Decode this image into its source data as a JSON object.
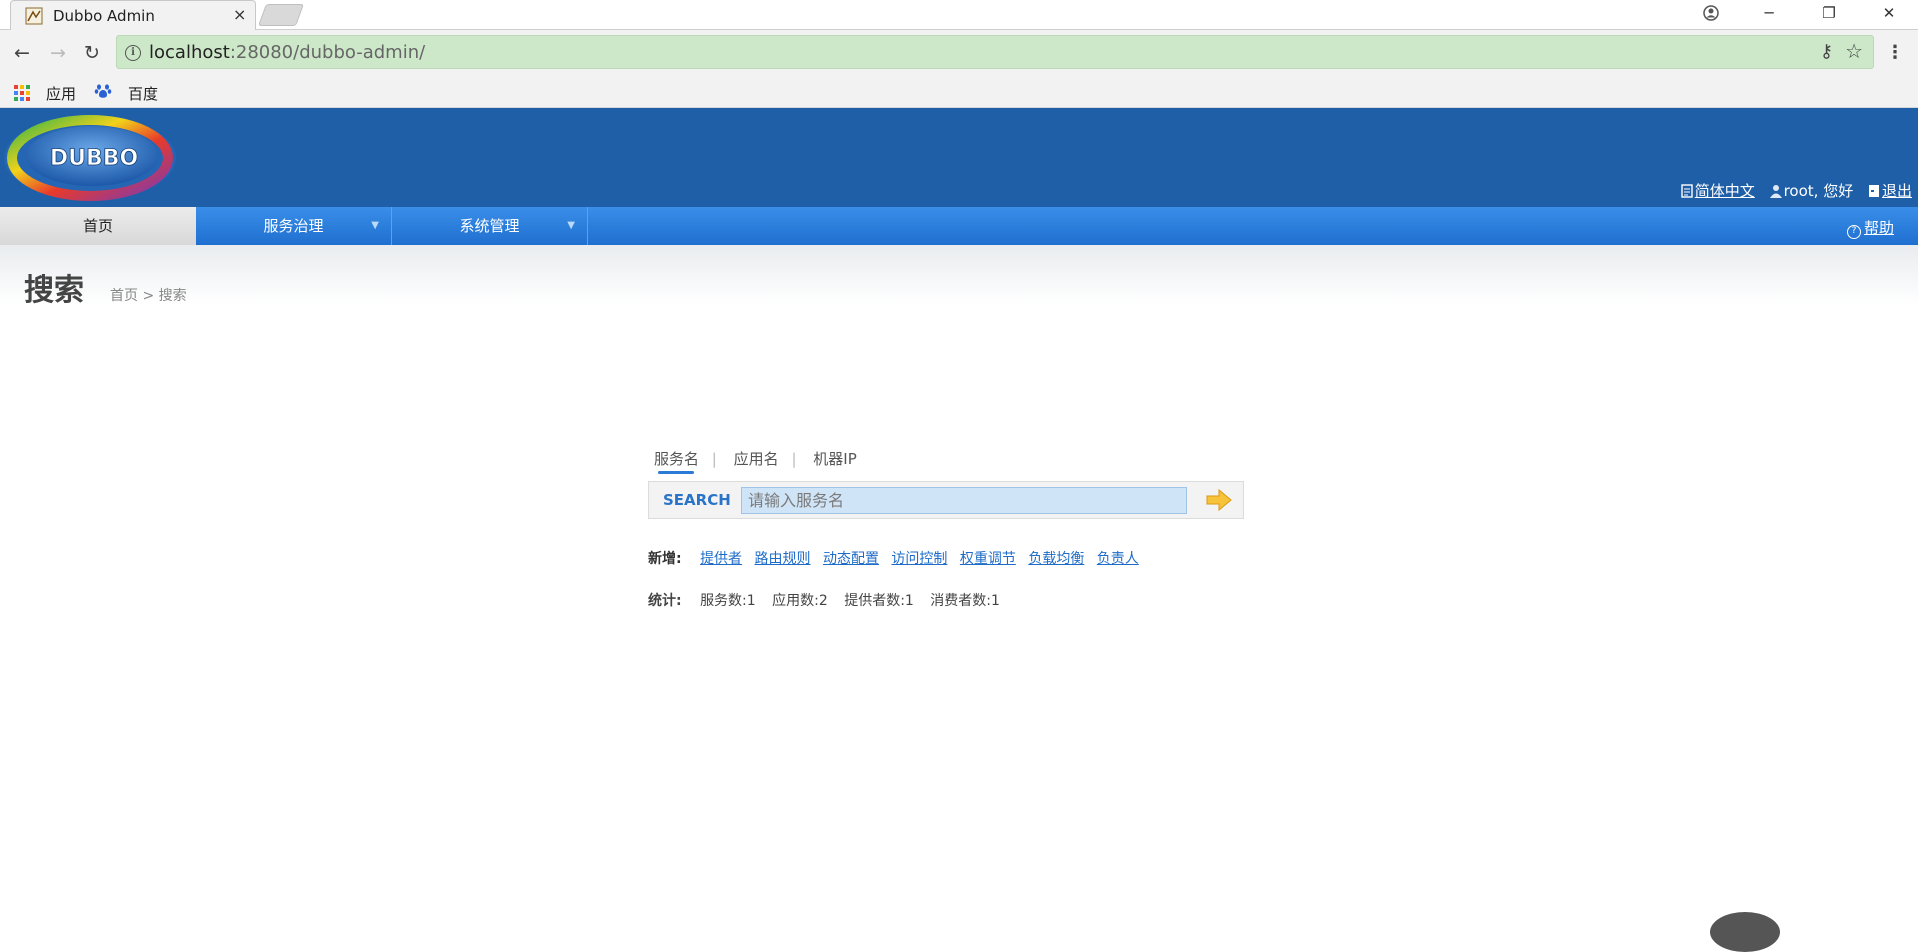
{
  "browser": {
    "tab_title": "Dubbo Admin",
    "tab_close": "×",
    "url_host": "localhost",
    "url_rest": ":28080/dubbo-admin/",
    "bookmarks": [
      "应用",
      "百度"
    ]
  },
  "header": {
    "logo_text": "DUBBO",
    "language": "简体中文",
    "greeting": "root, 您好",
    "logout": "退出"
  },
  "nav": {
    "items": [
      {
        "label": "首页"
      },
      {
        "label": "服务治理"
      },
      {
        "label": "系统管理"
      }
    ],
    "help": "帮助"
  },
  "page": {
    "title": "搜索",
    "breadcrumb": "首页 > 搜索"
  },
  "search": {
    "tabs": [
      "服务名",
      "应用名",
      "机器IP"
    ],
    "label": "SEARCH",
    "placeholder": "请输入服务名"
  },
  "add": {
    "label": "新增:",
    "links": [
      "提供者",
      "路由规则",
      "动态配置",
      "访问控制",
      "权重调节",
      "负载均衡",
      "负责人"
    ]
  },
  "stats": {
    "label": "统计:",
    "items": [
      "服务数:1",
      "应用数:2",
      "提供者数:1",
      "消费者数:1"
    ]
  },
  "colors": {
    "header_bg": "#1f5fa8",
    "nav_bg": "#2a7ad6",
    "link": "#1e6cc8",
    "omnibox": "#cde8c9"
  }
}
